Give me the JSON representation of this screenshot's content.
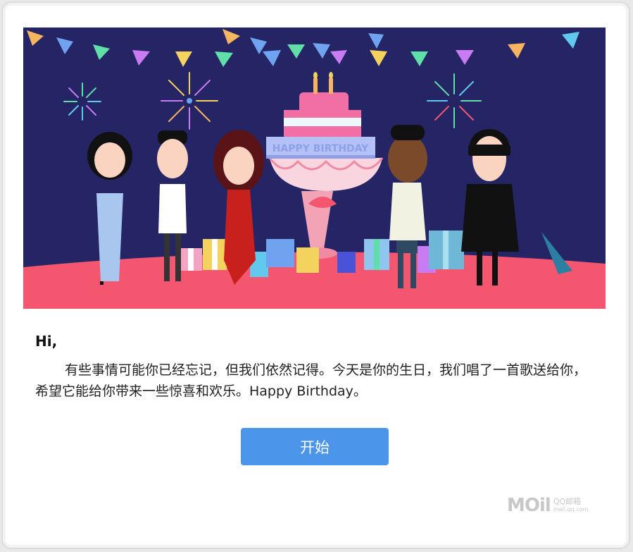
{
  "banner": {
    "cake_text": "HAPPY BIRTHDAY",
    "colors": {
      "sky": "#252566",
      "ground": "#f4566f",
      "cake_pink": "#f26fa6",
      "flags": [
        "#f6b55e",
        "#6fa3ef",
        "#5fe0a8",
        "#c97cf1",
        "#f4d25e",
        "#62c9ee"
      ]
    }
  },
  "email": {
    "greeting": "Hi,",
    "message": "有些事情可能你已经忘记，但我们依然记得。今天是你的生日，我们唱了一首歌送给你，希望它能给你带来一些惊喜和欢乐。Happy Birthday。"
  },
  "start_button": {
    "label": "开始",
    "color": "#4b95ea"
  },
  "footer_logo": {
    "mark": "MOil",
    "name": "QQ邮箱",
    "url": "mail.qq.com"
  }
}
